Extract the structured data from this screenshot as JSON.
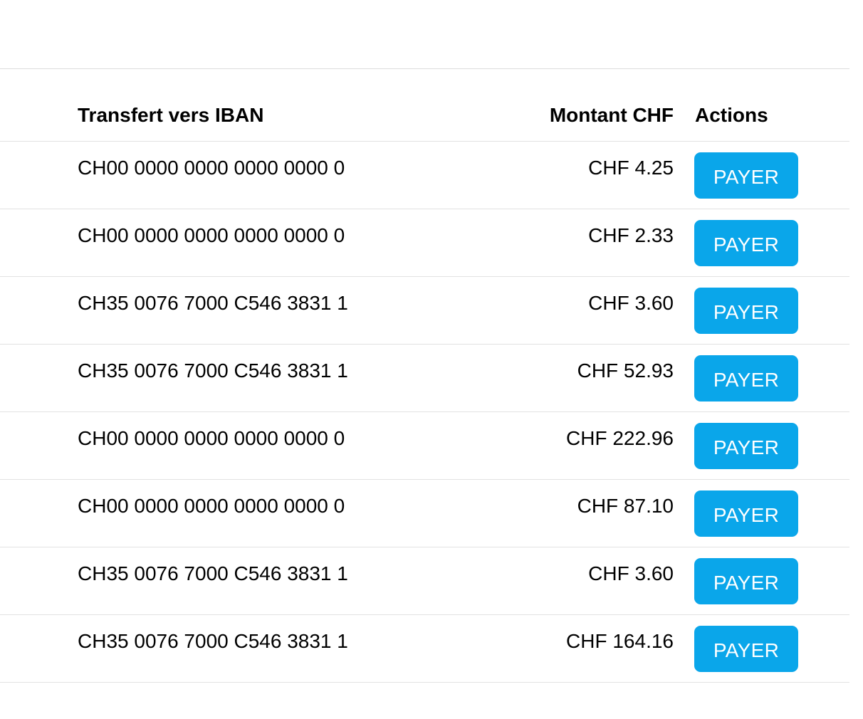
{
  "table": {
    "headers": {
      "iban": "Transfert vers IBAN",
      "amount": "Montant CHF",
      "actions": "Actions"
    },
    "rows": [
      {
        "iban": "CH00 0000 0000 0000 0000 0",
        "amount": "CHF 4.25",
        "action": "PAYER"
      },
      {
        "iban": "CH00 0000 0000 0000 0000 0",
        "amount": "CHF 2.33",
        "action": "PAYER"
      },
      {
        "iban": "CH35 0076 7000 C546 3831 1",
        "amount": "CHF 3.60",
        "action": "PAYER"
      },
      {
        "iban": "CH35 0076 7000 C546 3831 1",
        "amount": "CHF 52.93",
        "action": "PAYER"
      },
      {
        "iban": "CH00 0000 0000 0000 0000 0",
        "amount": "CHF 222.96",
        "action": "PAYER"
      },
      {
        "iban": "CH00 0000 0000 0000 0000 0",
        "amount": "CHF 87.10",
        "action": "PAYER"
      },
      {
        "iban": "CH35 0076 7000 C546 3831 1",
        "amount": "CHF 3.60",
        "action": "PAYER"
      },
      {
        "iban": "CH35 0076 7000 C546 3831 1",
        "amount": "CHF 164.16",
        "action": "PAYER"
      }
    ]
  },
  "colors": {
    "button_bg": "#0aa6ea",
    "button_text": "#ffffff",
    "divider": "#e2e2e2"
  }
}
